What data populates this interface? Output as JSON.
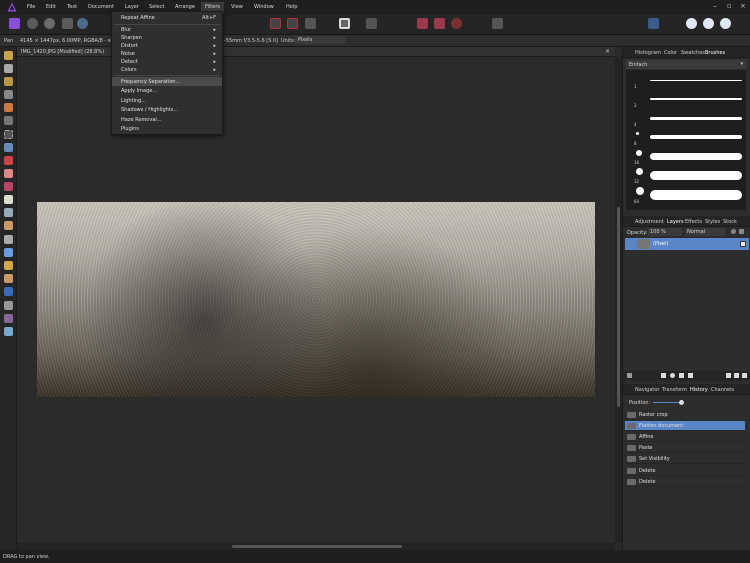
{
  "menubar": {
    "items": [
      "File",
      "Edit",
      "Text",
      "Document",
      "Layer",
      "Select",
      "Arrange",
      "Filters",
      "View",
      "Window",
      "Help"
    ],
    "active": "Filters",
    "window_controls": [
      "–",
      "▫",
      "×"
    ]
  },
  "filters_menu": {
    "repeat": {
      "label": "Repeat Affine",
      "shortcut": "Alt+F"
    },
    "submenus": [
      "Blur",
      "Sharpen",
      "Distort",
      "Noise",
      "Detect",
      "Colors"
    ],
    "items": [
      "Frequency Separation...",
      "Apply Image...",
      "Lighting...",
      "Shadows / Highlights...",
      "Haze Removal...",
      "Plugins"
    ],
    "highlighted": "Frequency Separation..."
  },
  "contextbar": {
    "tool": "Pan",
    "doc_info": "4145 × 1447px, 6.00MP, RGBA/8 - sRGB",
    "lens": "-55mm f/3.5-5.6 [S II]",
    "units_label": "Units:",
    "units_value": "Pixels"
  },
  "document": {
    "tab_title": "IMG_1420.JPG [Modified] (28.8%)"
  },
  "status": {
    "text": "DRAG to pan view."
  },
  "brushes_panel": {
    "tabs": [
      "Histogram",
      "Color",
      "Swatches",
      "Brushes"
    ],
    "selected_tab": "Brushes",
    "category": "Einfach",
    "brush_sizes": [
      "1",
      "2",
      "4",
      "8",
      "16",
      "32",
      "64"
    ]
  },
  "layers_panel": {
    "tabs": [
      "Adjustment",
      "Layers",
      "Effects",
      "Styles",
      "Stock"
    ],
    "selected_tab": "Layers",
    "opacity_label": "Opacity:",
    "opacity_value": "100 %",
    "blend_mode": "Normal",
    "layers": [
      {
        "name": "(Pixel)",
        "checked": true
      }
    ]
  },
  "history_panel": {
    "tabs": [
      "Navigator",
      "Transform",
      "History",
      "Channels"
    ],
    "selected_tab": "History",
    "position_label": "Position:",
    "position_fraction": 0.95,
    "entries": [
      "Raster crop",
      "Flatten document",
      "Affine",
      "Paste",
      "Set Visibility",
      "Delete",
      "Delete"
    ],
    "selected_entry": "Flatten document"
  },
  "colors": {
    "accent": "#5a86c8",
    "app_bg": "#2b2b2b",
    "logo": "#8a4fd8"
  }
}
